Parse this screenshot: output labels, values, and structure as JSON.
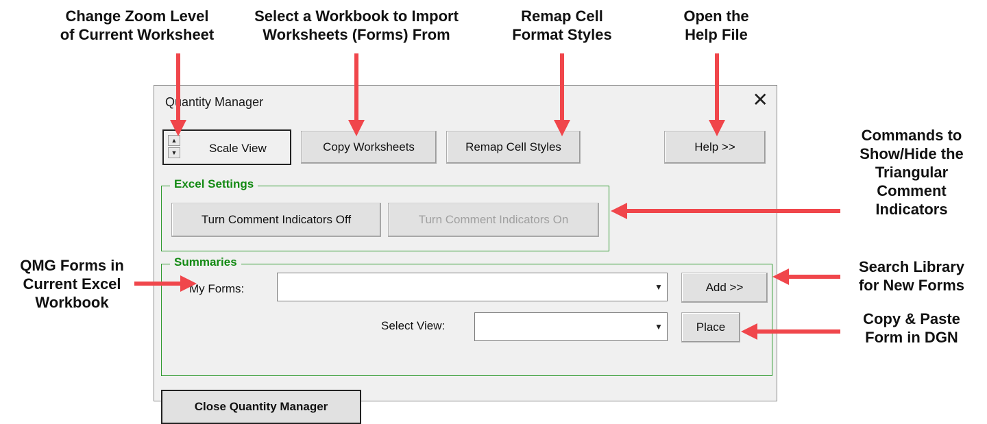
{
  "annotations": {
    "zoom": [
      "Change Zoom Level",
      "of Current Worksheet"
    ],
    "import": [
      "Select a Workbook to Import",
      "Worksheets (Forms) From"
    ],
    "remap": [
      "Remap Cell",
      "Format Styles"
    ],
    "help": [
      "Open the",
      "Help File"
    ],
    "comments": [
      "Commands to",
      "Show/Hide the",
      "Triangular",
      "Comment",
      "Indicators"
    ],
    "qmg": [
      "QMG Forms in",
      "Current Excel",
      "Workbook"
    ],
    "search": [
      "Search Library",
      "for New Forms"
    ],
    "copy_paste": [
      "Copy & Paste",
      "Form in DGN"
    ]
  },
  "dialog": {
    "title": "Quantity Manager",
    "close_glyph": "✕",
    "toolbar": {
      "scale_view": "Scale View",
      "copy_worksheets": "Copy Worksheets",
      "remap_cell_styles": "Remap Cell Styles",
      "help": "Help >>"
    },
    "excel_settings": {
      "legend": "Excel Settings",
      "comments_off": "Turn Comment Indicators Off",
      "comments_on": "Turn Comment Indicators On"
    },
    "summaries": {
      "legend": "Summaries",
      "my_forms_label": "My Forms:",
      "my_forms_value": "",
      "add": "Add >>",
      "select_view_label": "Select View:",
      "select_view_value": "",
      "place": "Place"
    },
    "close_button": "Close Quantity Manager"
  },
  "colors": {
    "arrow": "#f0464b",
    "group_border": "#2e9a2e",
    "legend": "#138a13"
  }
}
